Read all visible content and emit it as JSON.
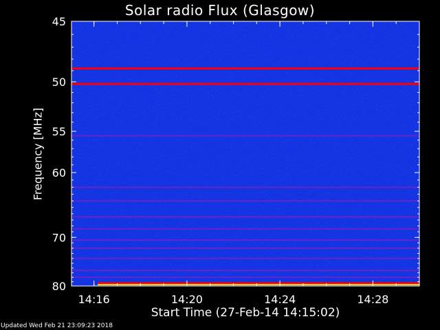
{
  "chart_data": {
    "type": "heatmap",
    "title": "Solar radio Flux (Glasgow)",
    "xlabel": "Start Time (27-Feb-14 14:15:02)",
    "ylabel": "Frequency [MHz]",
    "x_ticks": [
      "14:16",
      "14:20",
      "14:24",
      "14:28"
    ],
    "y_ticks": [
      45,
      50,
      55,
      60,
      70,
      80
    ],
    "y_scale": "reciprocal",
    "ylim": [
      45,
      80
    ],
    "xlim": [
      "14:15:02",
      "14:30:00"
    ],
    "colormap": [
      "#0000a0",
      "#1030e0",
      "#ff0000",
      "#ffd000"
    ],
    "bright_bands_mhz": [
      48.8,
      50.2,
      80.0
    ],
    "faint_bands_mhz": [
      55.5,
      62.0,
      64.0,
      66.5,
      68.5,
      70.5,
      72.0,
      74.0,
      76.5,
      78.0
    ]
  },
  "footer": {
    "updated": "Updated Wed Feb 21 23:09:23 2018"
  }
}
